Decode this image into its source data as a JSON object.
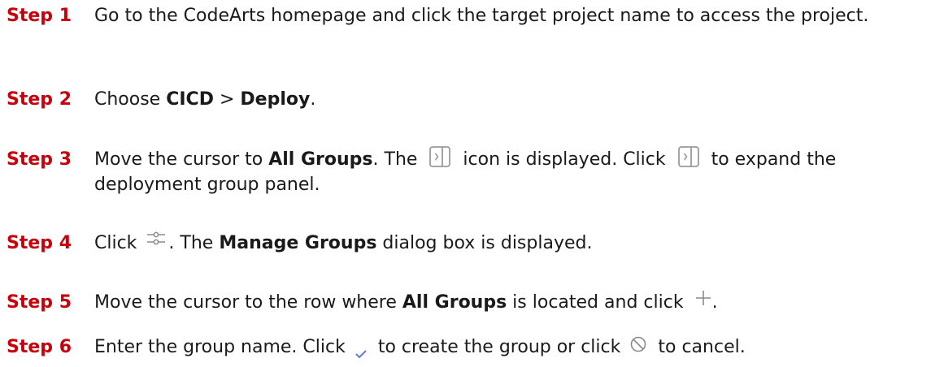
{
  "steps": [
    {
      "label": "Step 1",
      "parts": [
        "Go to the CodeArts homepage and click the target project name to access the project."
      ]
    },
    {
      "label": "Step 2",
      "parts": [
        "Choose ",
        "CICD",
        " > ",
        "Deploy",
        "."
      ]
    },
    {
      "label": "Step 3",
      "parts": [
        "Move the cursor to ",
        "All Groups",
        ". The ",
        " icon is displayed. Click ",
        " to expand the deployment group panel."
      ]
    },
    {
      "label": "Step 4",
      "parts": [
        "Click ",
        ". The ",
        "Manage Groups",
        " dialog box is displayed."
      ]
    },
    {
      "label": "Step 5",
      "parts": [
        "Move the cursor to the row where ",
        "All Groups",
        " is located and click ",
        "."
      ]
    },
    {
      "label": "Step 6",
      "parts": [
        "Enter the group name. Click ",
        " to create the group or click ",
        " to cancel."
      ]
    }
  ],
  "icons": {
    "panel_toggle": "expand-panel-icon",
    "manage_groups": "manage-groups-settings-icon",
    "add": "plus-icon",
    "confirm": "check-icon",
    "cancel": "cancel-circle-icon"
  },
  "colors": {
    "step_label": "#c7000b",
    "text": "#1a1a1a",
    "icon_gray": "#8a8a8a",
    "check_blue": "#5e7ce0"
  }
}
